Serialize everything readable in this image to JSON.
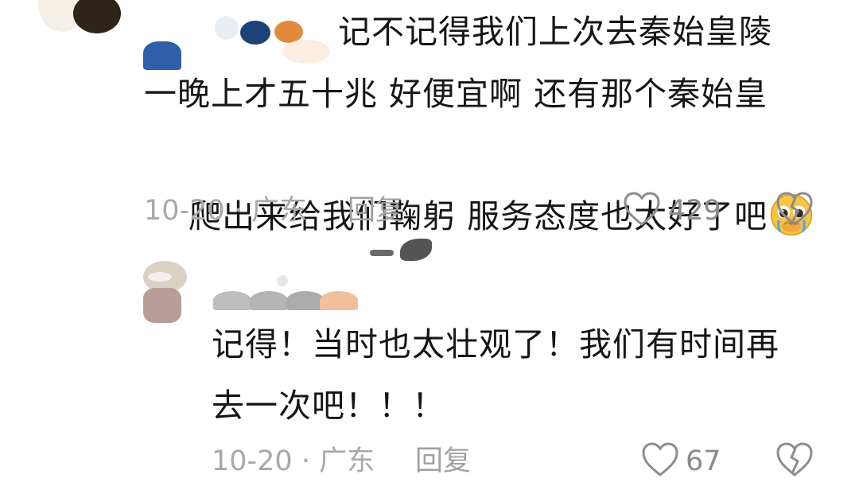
{
  "comments": [
    {
      "text_line1": "记不记得我们上次去秦始皇陵",
      "text_line2": "一晚上才五十兆 好便宜啊 还有那个秦始皇",
      "text_line3": "爬出来给我们鞠躬 服务态度也太好了吧",
      "emoji": "pleading-face-crying-emoji",
      "date_location": "10-20 · 广东",
      "reply_label": "回复",
      "like_count": "429"
    },
    {
      "text_line1": "记得！当时也太壮观了！我们有时间再",
      "text_line2": "去一次吧！！！",
      "date_location": "10-20 · 广东",
      "reply_label": "回复",
      "like_count": "67"
    }
  ],
  "icons": {
    "like": "heart-outline-icon",
    "dislike": "broken-heart-icon"
  }
}
